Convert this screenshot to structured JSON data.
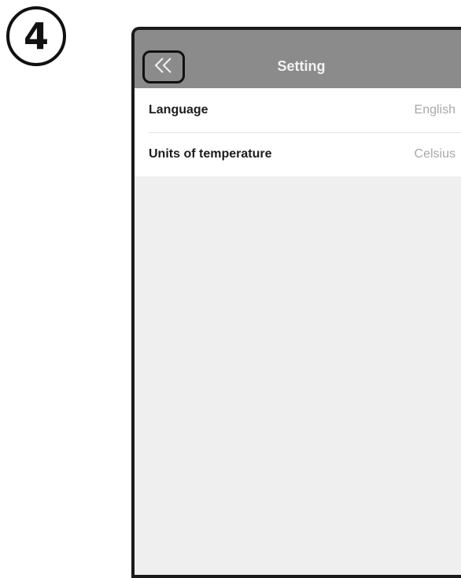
{
  "step": {
    "number": "4"
  },
  "nav": {
    "title": "Setting",
    "back_icon": "double-chevron-left-icon"
  },
  "settings": [
    {
      "label": "Language",
      "value": "English"
    },
    {
      "label": "Units of temperature",
      "value": "Celsius"
    }
  ],
  "colors": {
    "nav_bar": "#8b8b8b",
    "screen_bg": "#efefef",
    "row_bg": "#ffffff",
    "value_text": "#a8a8a8"
  }
}
